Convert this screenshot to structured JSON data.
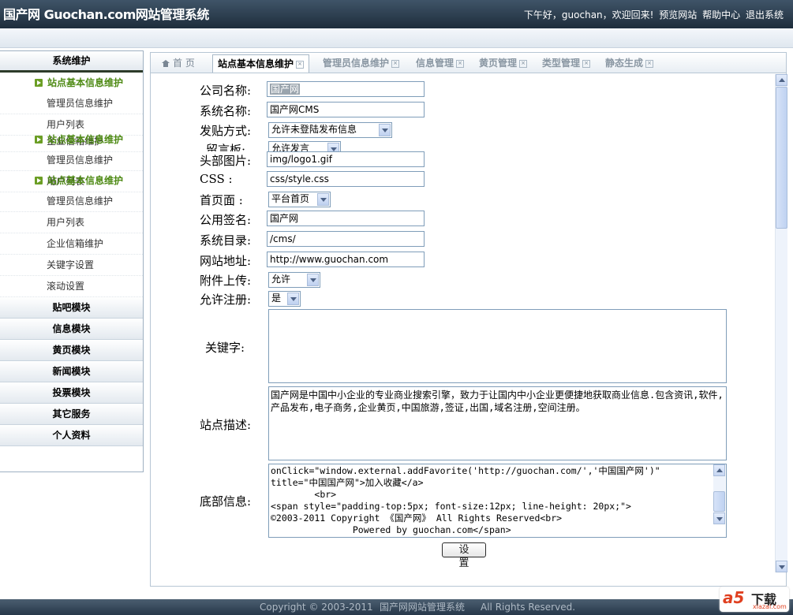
{
  "header": {
    "title": "国产网 Guochan.com网站管理系统",
    "greeting": "下午好，guochan，欢迎回来!",
    "links": [
      "预览网站",
      "帮助中心",
      "退出系统"
    ]
  },
  "sidebar": {
    "section_active": "系统维护",
    "groups": [
      {
        "title": "站点基本信息维护",
        "items": [
          "管理员信息维护",
          "用户列表",
          "企业信箱维护"
        ]
      },
      {
        "title": "站点基本信息维护",
        "items": [
          "管理员信息维护",
          "用户列表"
        ]
      },
      {
        "title": "站点基本信息维护",
        "items": [
          "管理员信息维护",
          "用户列表",
          "企业信箱维护",
          "关键字设置",
          "滚动设置"
        ]
      }
    ],
    "modules": [
      "贴吧模块",
      "信息模块",
      "黄页模块",
      "新闻模块",
      "投票模块",
      "其它服务",
      "个人资料"
    ]
  },
  "tabs": {
    "home": "首 页",
    "items": [
      "站点基本信息维护",
      "管理员信息维护",
      "信息管理",
      "黄页管理",
      "类型管理",
      "静态生成"
    ]
  },
  "form": {
    "company_name": {
      "label": "公司名称:",
      "value": "国产网"
    },
    "system_name": {
      "label": "系统名称:",
      "value": "国产网CMS"
    },
    "post_mode": {
      "label": "发贴方式:",
      "value": "允许未登陆发布信息"
    },
    "message_board": {
      "label": "留言板:",
      "value": "允许发言"
    },
    "header_image": {
      "label": "头部图片:",
      "value": "img/logo1.gif"
    },
    "css": {
      "label": "CSS    :",
      "value": "css/style.css"
    },
    "home_page": {
      "label": "首页面  :",
      "value": "平台首页"
    },
    "signature": {
      "label": "公用签名:",
      "value": "国产网"
    },
    "system_dir": {
      "label": "系统目录:",
      "value": "/cms/"
    },
    "site_url": {
      "label": "网站地址:",
      "value": "http://www.guochan.com"
    },
    "attachment": {
      "label": "附件上传:",
      "value": "允许"
    },
    "registration": {
      "label": "允许注册:",
      "value": "是"
    },
    "keywords": {
      "label": "关键字:",
      "value": ""
    },
    "description": {
      "label": "站点描述:",
      "value": "国产网是中国中小企业的专业商业搜索引擎，致力于让国内中小企业更便捷地获取商业信息.包含资讯,软件,产品发布,电子商务,企业黄页,中国旅游,签证,出国,域名注册,空间注册。"
    },
    "footer_info": {
      "label": "底部信息:",
      "value": "onClick=\"window.external.addFavorite('http://guochan.com/','中国国产网')\"\ntitle=\"中国国产网\">加入收藏</a>\n        <br>\n<span style=\"padding-top:5px; font-size:12px; line-height: 20px;\">\n©2003-2011 Copyright 《国产网》 All Rights Reserved<br>\n               Powered by guochan.com</span>"
    },
    "submit": "设 置"
  },
  "footer": {
    "copyright": "Copyright © 2003-2011",
    "system": "国产网网站管理系统",
    "rights": "All Rights Reserved."
  },
  "watermark": {
    "brand": "a5",
    "text": "下载",
    "site": "xiazai.com"
  }
}
